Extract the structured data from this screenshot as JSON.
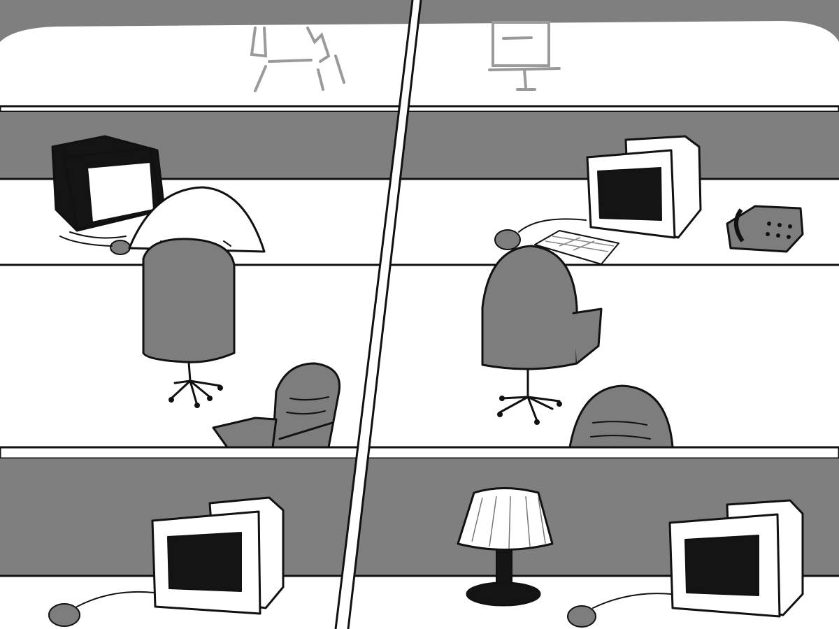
{
  "scene": {
    "description_kind": "sketch",
    "colors": {
      "wall_gray": "#7f7f7f",
      "chair_gray": "#7d7d7d",
      "paper_white": "#ffffff",
      "ink": "#111111",
      "screen_dark": "#141414"
    },
    "objects": [
      "back-window",
      "flip-chart-left",
      "projector-screen-right",
      "cubicle-wall-top",
      "cubicle-wall-bottom",
      "crt-monitor",
      "desk-lamp",
      "desk-phone",
      "keyboard",
      "computer-mouse",
      "office-chair",
      "panel-divider"
    ]
  }
}
